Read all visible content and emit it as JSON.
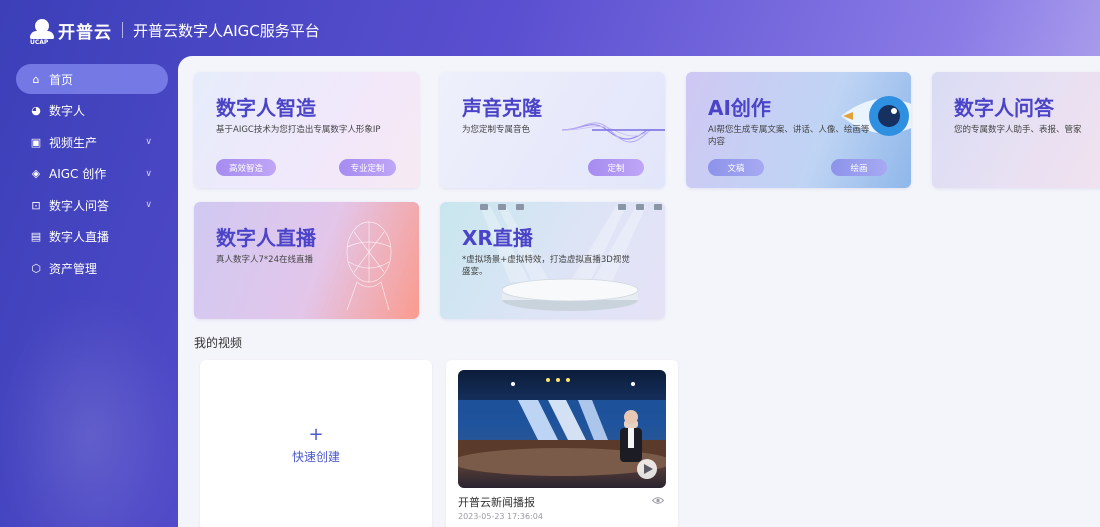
{
  "header": {
    "logo_sub": "UCAP",
    "brand": "开普云",
    "title": "开普云数字人AIGC服务平台"
  },
  "sidebar": {
    "items": [
      {
        "label": "首页",
        "icon": "home-icon",
        "active": true,
        "expandable": false
      },
      {
        "label": "数字人",
        "icon": "robot-icon",
        "active": false,
        "expandable": false
      },
      {
        "label": "视频生产",
        "icon": "video-icon",
        "active": false,
        "expandable": true
      },
      {
        "label": "AIGC 创作",
        "icon": "bulb-icon",
        "active": false,
        "expandable": true
      },
      {
        "label": "数字人问答",
        "icon": "qa-icon",
        "active": false,
        "expandable": true
      },
      {
        "label": "数字人直播",
        "icon": "live-icon",
        "active": false,
        "expandable": false
      },
      {
        "label": "资产管理",
        "icon": "assets-icon",
        "active": false,
        "expandable": false
      }
    ]
  },
  "cards": {
    "smart": {
      "title": "数字人智造",
      "desc": "基于AIGC技术为您打造出专属数字人形象IP",
      "btn1": "高效智造",
      "btn2": "专业定制"
    },
    "voice": {
      "title": "声音克隆",
      "desc": "为您定制专属音色",
      "btn1": "定制"
    },
    "ai": {
      "title": "AI创作",
      "desc": "AI帮您生成专属文案、讲话、人像、绘画等内容",
      "btn1": "文稿",
      "btn2": "绘画"
    },
    "qa": {
      "title": "数字人问答",
      "desc": "您的专属数字人助手、表报、管家"
    },
    "live": {
      "title": "数字人直播",
      "desc": "真人数字人7*24在线直播"
    },
    "xr": {
      "title": "XR直播",
      "desc": "*虚拟场景+虚拟特效，打造虚拟直播3D视觉盛宴。"
    }
  },
  "videos": {
    "section_title": "我的视频",
    "create_plus": "+",
    "create_label": "快速创建",
    "items": [
      {
        "title": "开普云新闻播报",
        "time": "2023-05-23 17:36:04"
      }
    ]
  },
  "colors": {
    "accent": "#4b44c8",
    "sidebar_active": "#7d82eb"
  }
}
